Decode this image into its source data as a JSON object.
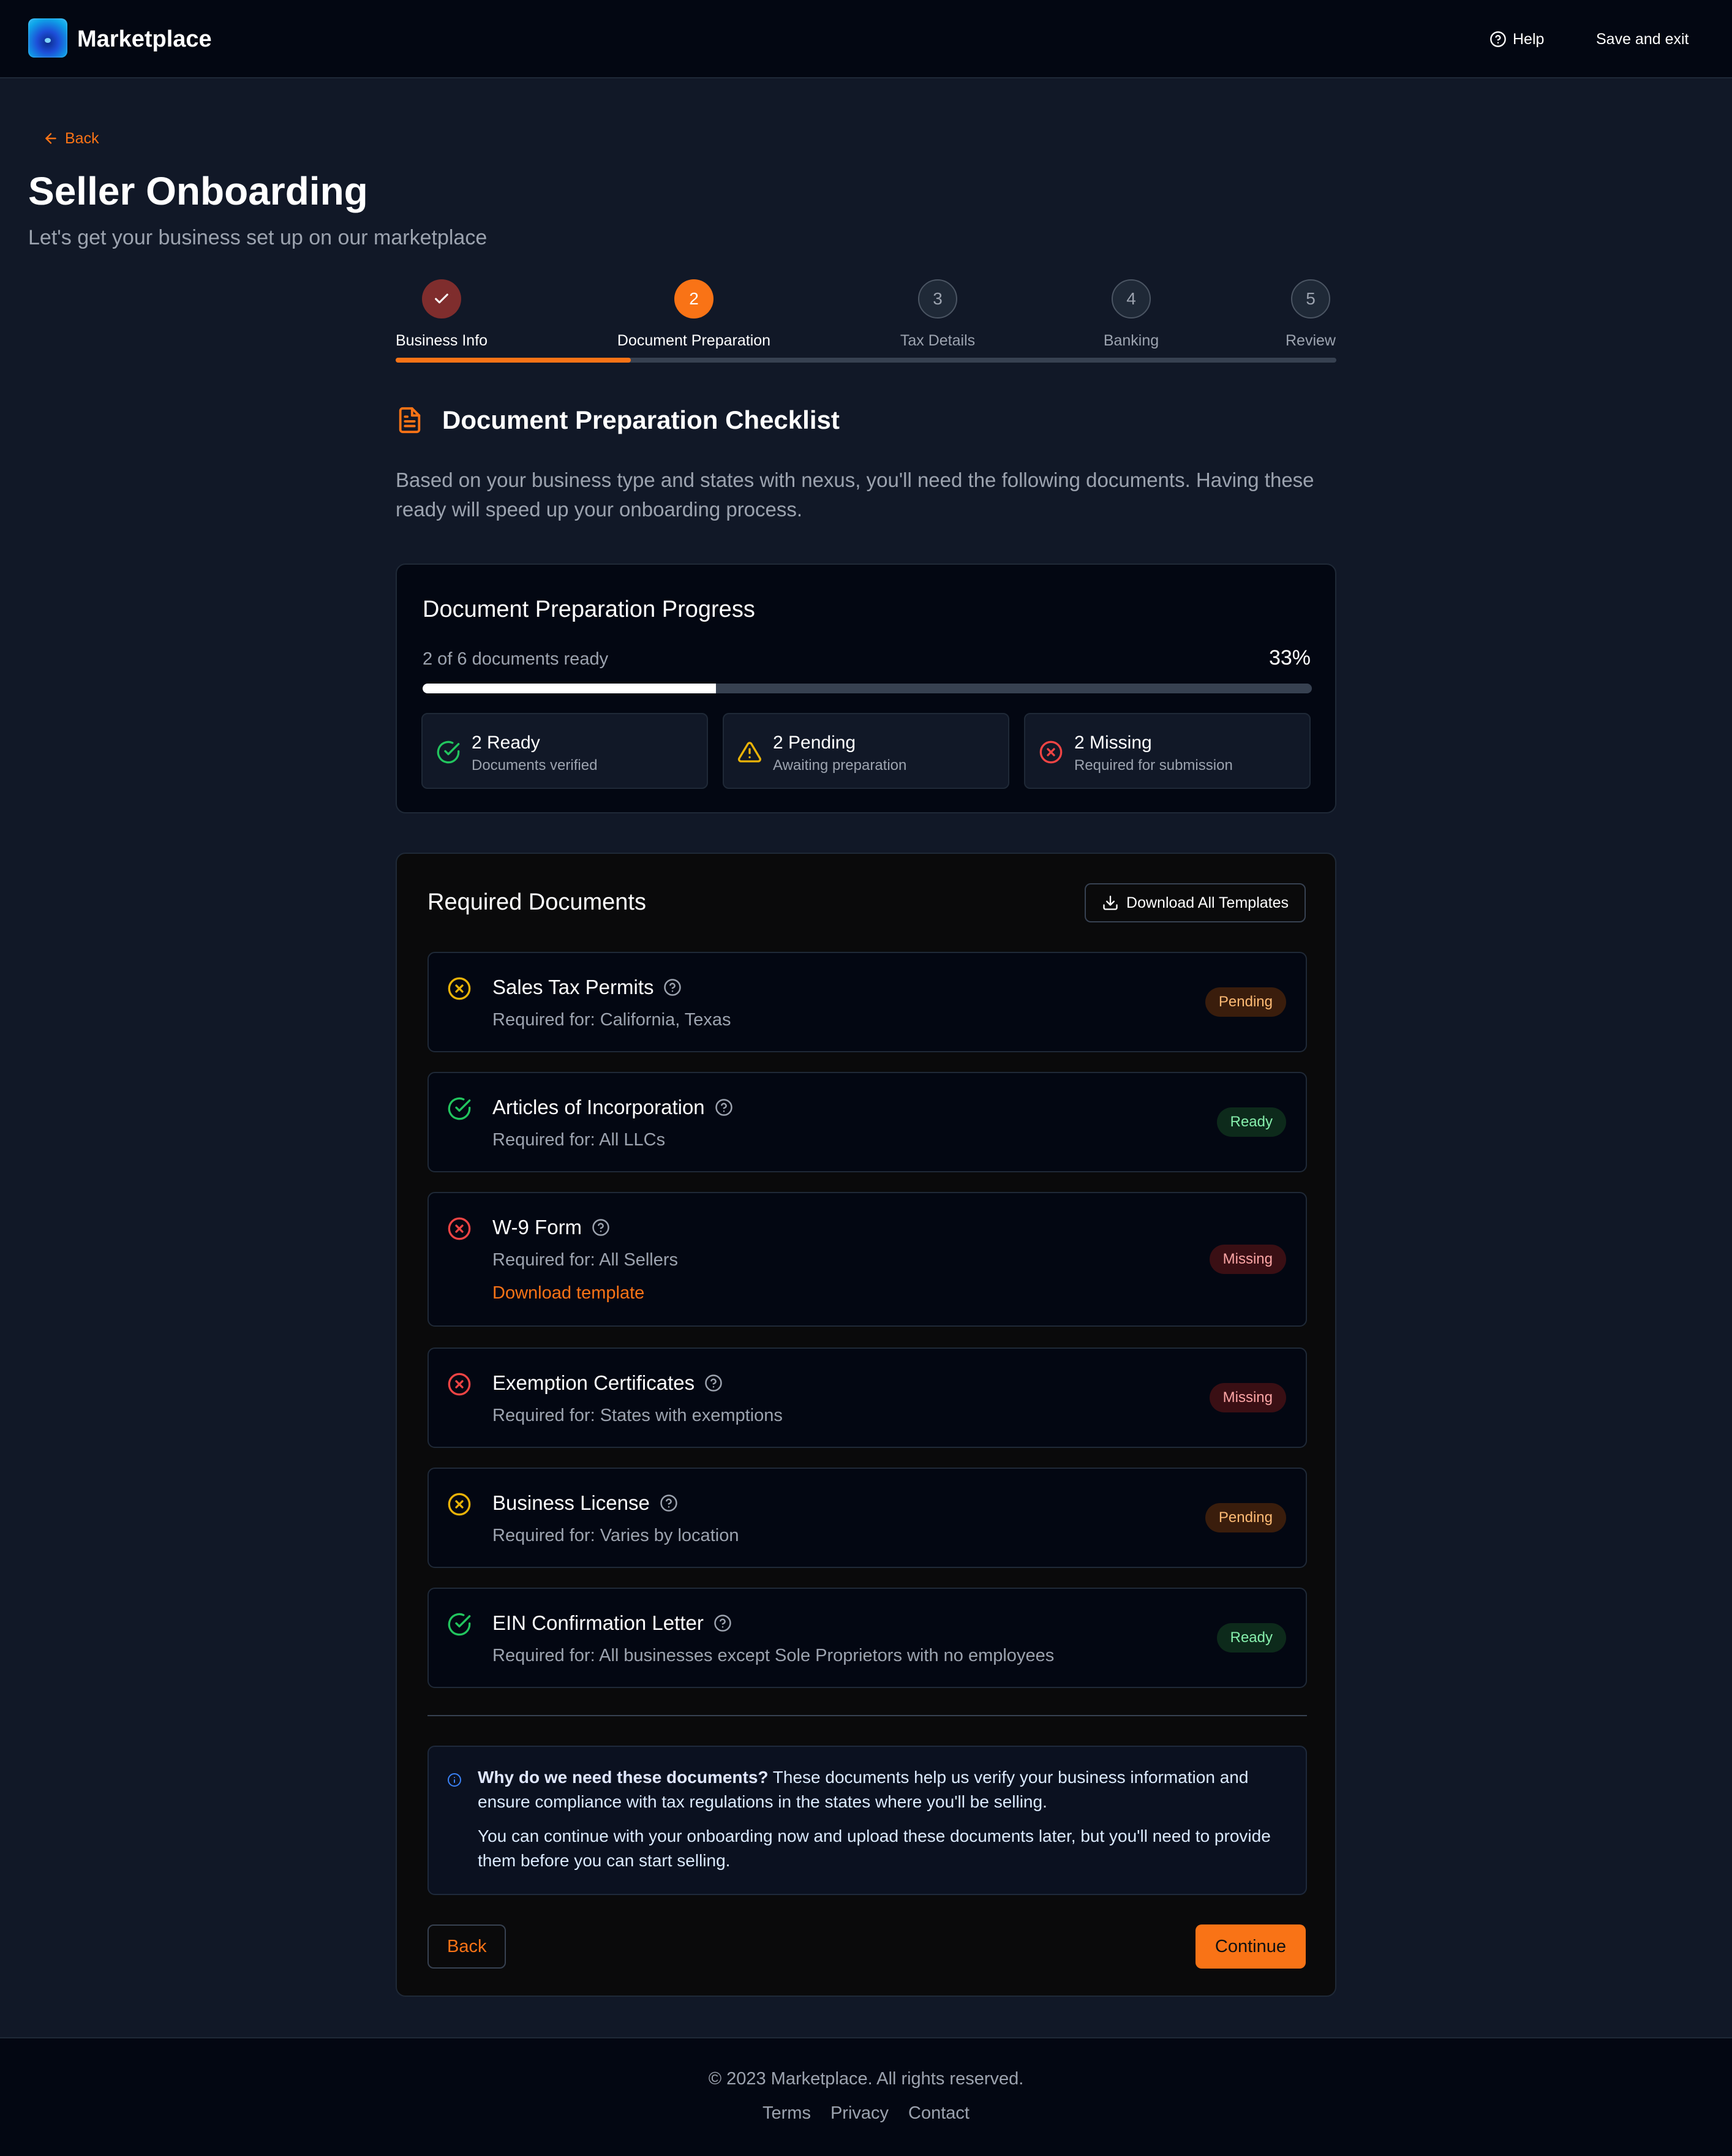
{
  "header": {
    "brand": "Marketplace",
    "help_label": "Help",
    "save_exit_label": "Save and exit"
  },
  "page": {
    "back_label": "Back",
    "title": "Seller Onboarding",
    "subtitle": "Let's get your business set up on our marketplace"
  },
  "stepper": {
    "steps": [
      {
        "number": "",
        "label": "Business Info",
        "state": "done"
      },
      {
        "number": "2",
        "label": "Document Preparation",
        "state": "active"
      },
      {
        "number": "3",
        "label": "Tax Details",
        "state": "todo"
      },
      {
        "number": "4",
        "label": "Banking",
        "state": "todo"
      },
      {
        "number": "5",
        "label": "Review",
        "state": "todo"
      }
    ],
    "progress_fraction": 0.25
  },
  "checklist": {
    "title": "Document Preparation Checklist",
    "intro": "Based on your business type and states with nexus, you'll need the following documents. Having these ready will speed up your onboarding process."
  },
  "progress": {
    "title": "Document Preparation Progress",
    "count_text": "2 of 6 documents ready",
    "percent_text": "33%",
    "fraction": 0.33,
    "stats": [
      {
        "main": "2 Ready",
        "sub": "Documents verified",
        "icon": "check-circle-icon"
      },
      {
        "main": "2 Pending",
        "sub": "Awaiting preparation",
        "icon": "warning-triangle-icon"
      },
      {
        "main": "2 Missing",
        "sub": "Required for submission",
        "icon": "x-circle-icon"
      }
    ]
  },
  "documents": {
    "title": "Required Documents",
    "download_all_label": "Download All Templates",
    "items": [
      {
        "name": "Sales Tax Permits",
        "requirement": "Required for: California, Texas",
        "status": "Pending"
      },
      {
        "name": "Articles of Incorporation",
        "requirement": "Required for: All LLCs",
        "status": "Ready"
      },
      {
        "name": "W-9 Form",
        "requirement": "Required for: All Sellers",
        "status": "Missing",
        "link": "Download template"
      },
      {
        "name": "Exemption Certificates",
        "requirement": "Required for: States with exemptions",
        "status": "Missing"
      },
      {
        "name": "Business License",
        "requirement": "Required for: Varies by location",
        "status": "Pending"
      },
      {
        "name": "EIN Confirmation Letter",
        "requirement": "Required for: All businesses except Sole Proprietors with no employees",
        "status": "Ready"
      }
    ]
  },
  "info": {
    "bold": "Why do we need these documents?",
    "text1": " These documents help us verify your business information and ensure compliance with tax regulations in the states where you'll be selling.",
    "text2": "You can continue with your onboarding now and upload these documents later, but you'll need to provide them before you can start selling."
  },
  "actions": {
    "back_label": "Back",
    "continue_label": "Continue"
  },
  "footer": {
    "copyright": "© 2023 Marketplace. All rights reserved.",
    "links": [
      "Terms",
      "Privacy",
      "Contact"
    ]
  },
  "colors": {
    "accent": "#f97316",
    "ready": "#22c55e",
    "pending": "#eab308",
    "missing": "#ef4444"
  }
}
